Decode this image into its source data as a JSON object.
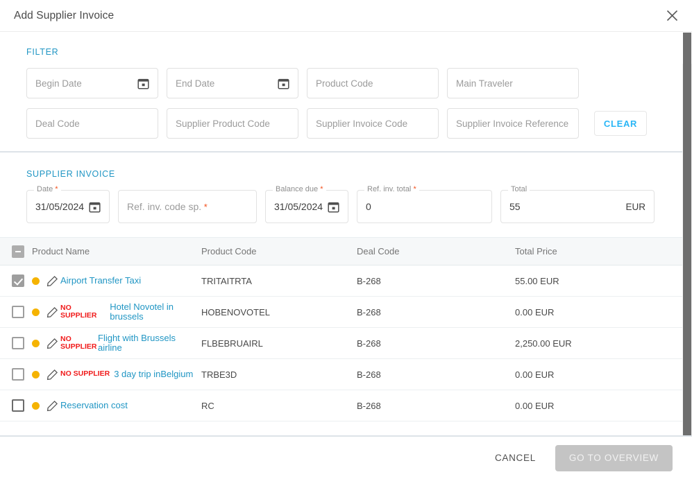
{
  "dialog": {
    "title": "Add Supplier Invoice",
    "close_icon": "close-icon"
  },
  "filter": {
    "label": "FILTER",
    "fields_row1": [
      {
        "placeholder": "Begin Date",
        "icon": "calendar-icon"
      },
      {
        "placeholder": "End Date",
        "icon": "calendar-icon"
      },
      {
        "placeholder": "Product Code",
        "icon": ""
      },
      {
        "placeholder": "Main Traveler",
        "icon": ""
      }
    ],
    "fields_row2": [
      {
        "placeholder": "Deal Code",
        "icon": ""
      },
      {
        "placeholder": "Supplier Product Code",
        "icon": ""
      },
      {
        "placeholder": "Supplier Invoice Code",
        "icon": ""
      },
      {
        "placeholder": "Supplier Invoice Reference",
        "icon": ""
      }
    ],
    "clear_label": "CLEAR"
  },
  "supplier_invoice": {
    "label": "SUPPLIER INVOICE",
    "fields": [
      {
        "label": "Date",
        "required": true,
        "value": "31/05/2024",
        "placeholder": "",
        "icon": "calendar-icon",
        "suffix": ""
      },
      {
        "label": "",
        "required": true,
        "value": "",
        "placeholder": "Ref. inv. code sp.",
        "icon": "",
        "suffix": ""
      },
      {
        "label": "Balance due",
        "required": true,
        "value": "31/05/2024",
        "placeholder": "",
        "icon": "calendar-icon",
        "suffix": ""
      },
      {
        "label": "Ref. inv. total",
        "required": true,
        "value": "0",
        "placeholder": "",
        "icon": "",
        "suffix": ""
      },
      {
        "label": "Total",
        "required": false,
        "value": "55",
        "placeholder": "",
        "icon": "",
        "suffix": "EUR"
      }
    ]
  },
  "table": {
    "select_all_state": "indeterminate",
    "columns": [
      "Product Name",
      "Product Code",
      "Deal Code",
      "Total Price"
    ],
    "rows": [
      {
        "checked": true,
        "status_dot": "amber",
        "badge": "",
        "product_name": "Airport Transfer Taxi",
        "product_code": "TRITAITRTA",
        "deal_code": "B-268",
        "total_price": "55.00",
        "currency": "EUR"
      },
      {
        "checked": false,
        "status_dot": "amber",
        "badge": "NO SUPPLIER",
        "product_name": "Hotel Novotel in brussels",
        "product_code": "HOBENOVOTEL",
        "deal_code": "B-268",
        "total_price": "0.00",
        "currency": "EUR"
      },
      {
        "checked": false,
        "status_dot": "amber",
        "badge": "NO SUPPLIER",
        "product_name": "Flight with Brussels airline",
        "product_code": "FLBEBRUAIRL",
        "deal_code": "B-268",
        "total_price": "2,250.00",
        "currency": "EUR"
      },
      {
        "checked": false,
        "status_dot": "amber",
        "badge": "NO SUPPLIER",
        "product_name": "3 day trip inBelgium",
        "product_code": "TRBE3D",
        "deal_code": "B-268",
        "total_price": "0.00",
        "currency": "EUR"
      },
      {
        "checked": false,
        "status_dot": "amber",
        "badge": "",
        "product_name": "Reservation cost",
        "product_code": "RC",
        "deal_code": "B-268",
        "total_price": "0.00",
        "currency": "EUR"
      }
    ]
  },
  "footer": {
    "cancel_label": "CANCEL",
    "primary_label": "GO TO OVERVIEW"
  },
  "colors": {
    "accent_blue": "#2196c4",
    "link_blue": "#2196c4",
    "clear_blue": "#29b6f6",
    "required_red": "#f4511e",
    "badge_red": "#f01a1a",
    "status_amber": "#f5b301",
    "primary_disabled": "#c4c4c4"
  }
}
